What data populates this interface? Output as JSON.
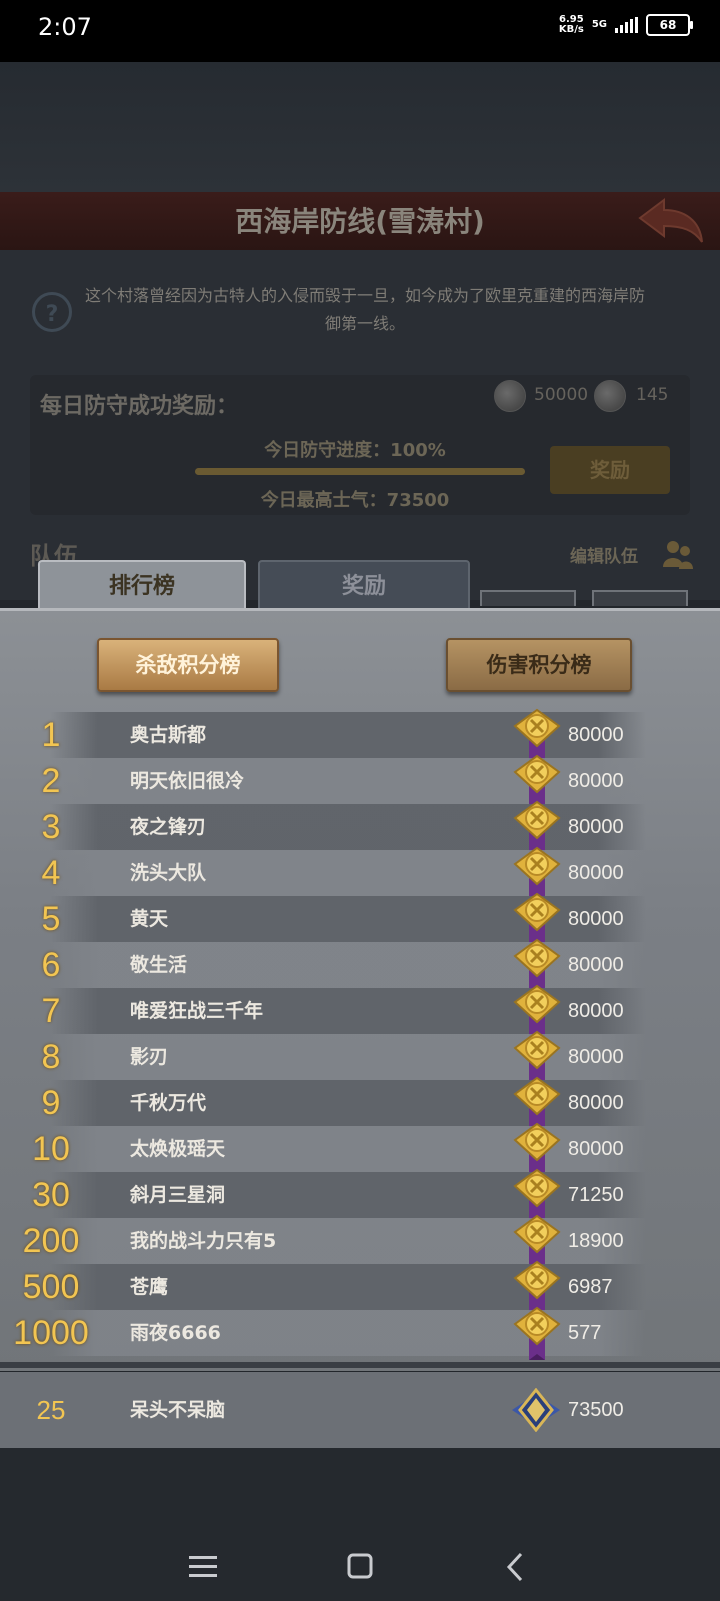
{
  "status_bar": {
    "time": "2:07",
    "net_speed_value": "6.95",
    "net_speed_unit": "KB/s",
    "network": "5G",
    "battery": "68"
  },
  "header": {
    "title": "西海岸防线(雪涛村)",
    "description": "这个村落曾经因为古特人的入侵而毁于一旦，如今成为了欧里克重建的西海岸防御第一线。"
  },
  "daily_reward": {
    "label": "每日防守成功奖励：",
    "coin_amount": "50000",
    "gem_amount": "145",
    "progress_label": "今日防守进度：100%",
    "progress": 1.0,
    "morale_label": "今日最高士气：73500",
    "reward_button": "奖励"
  },
  "team": {
    "label": "队伍",
    "edit_label": "编辑队伍"
  },
  "tabs": [
    {
      "label": "排行榜",
      "active": true
    },
    {
      "label": "奖励",
      "active": false
    }
  ],
  "boards": {
    "kill": "杀敌积分榜",
    "damage": "伤害积分榜"
  },
  "rankings": [
    {
      "rank": "1",
      "name": "奥古斯都",
      "score": "80000"
    },
    {
      "rank": "2",
      "name": "明天依旧很冷",
      "score": "80000"
    },
    {
      "rank": "3",
      "name": "夜之锋刃",
      "score": "80000"
    },
    {
      "rank": "4",
      "name": "洗头大队",
      "score": "80000"
    },
    {
      "rank": "5",
      "name": "黄天",
      "score": "80000"
    },
    {
      "rank": "6",
      "name": "敬生活",
      "score": "80000"
    },
    {
      "rank": "7",
      "name": "唯爱狂战三千年",
      "score": "80000"
    },
    {
      "rank": "8",
      "name": "影刃",
      "score": "80000"
    },
    {
      "rank": "9",
      "name": "千秋万代",
      "score": "80000"
    },
    {
      "rank": "10",
      "name": "太焕极瑶天",
      "score": "80000"
    },
    {
      "rank": "30",
      "name": "斜月三星洞",
      "score": "71250"
    },
    {
      "rank": "200",
      "name": "我的战斗力只有5",
      "score": "18900"
    },
    {
      "rank": "500",
      "name": "苍鹰",
      "score": "6987"
    },
    {
      "rank": "1000",
      "name": "雨夜6666",
      "score": "577"
    }
  ],
  "self": {
    "rank": "25",
    "name": "呆头不呆脑",
    "score": "73500"
  },
  "colors": {
    "gold": "#f2c552",
    "medal_ribbon": "#6b2f8a",
    "panel": "#7b7f85"
  }
}
